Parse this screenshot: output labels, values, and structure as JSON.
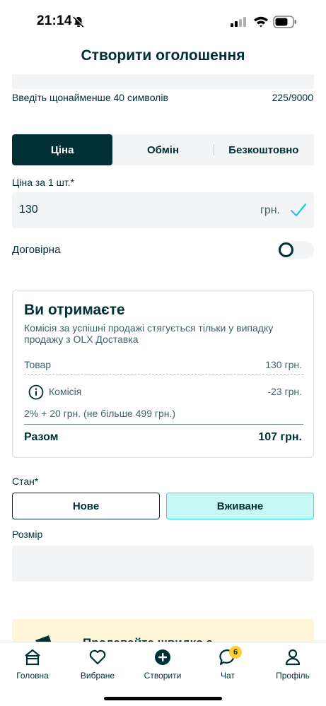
{
  "status_bar": {
    "time": "21:14"
  },
  "header": {
    "title": "Створити оголошення"
  },
  "description": {
    "hint": "Введіть щонайменше 40 символів",
    "counter": "225/9000"
  },
  "price_tabs": [
    {
      "label": "Ціна",
      "active": true
    },
    {
      "label": "Обмін",
      "active": false
    },
    {
      "label": "Безкоштовно",
      "active": false
    }
  ],
  "price": {
    "label": "Ціна за 1 шт.*",
    "value": "130",
    "currency": "грн."
  },
  "negotiable": {
    "label": "Договірна",
    "enabled": false
  },
  "receive": {
    "title": "Ви отримаєте",
    "note": "Комісія за успішні продажі стягується тільки у випадку продажу з OLX Доставка",
    "item_label": "Товар",
    "item_value": "130 грн.",
    "commission_label": "Комісія",
    "commission_value": "-23 грн.",
    "commission_rule": "2% + 20 грн. (не більше 499 грн.)",
    "total_label": "Разом",
    "total_value": "107 грн."
  },
  "condition": {
    "label": "Стан*",
    "options": [
      "Нове",
      "Вживане"
    ],
    "selected": "Вживане"
  },
  "size": {
    "label": "Розмір"
  },
  "promo": {
    "text": "Продавайте швидко з"
  },
  "nav": {
    "items": [
      {
        "label": "Головна",
        "icon": "home-icon"
      },
      {
        "label": "Вибране",
        "icon": "heart-icon"
      },
      {
        "label": "Створити",
        "icon": "plus-circle-icon"
      },
      {
        "label": "Чат",
        "icon": "chat-icon"
      },
      {
        "label": "Профіль",
        "icon": "profile-icon"
      }
    ],
    "chat_badge": "6"
  },
  "colors": {
    "primary": "#002f34",
    "accent": "#23e5db",
    "selected_bg": "#c8f8f6",
    "badge": "#ffce32",
    "field_bg": "#f2f4f5"
  }
}
